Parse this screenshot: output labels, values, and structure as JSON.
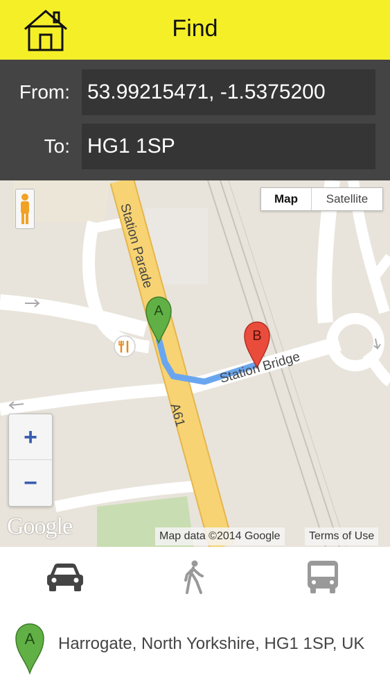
{
  "header": {
    "title": "Find",
    "home_icon": "home-icon",
    "background_color": "#f5ef28"
  },
  "route": {
    "from_label": "From:",
    "from_value": "53.99215471, -1.5375200",
    "to_label": "To:",
    "to_value": "HG1 1SP"
  },
  "map": {
    "type_map_label": "Map",
    "type_satellite_label": "Satellite",
    "zoom_in_label": "+",
    "zoom_out_label": "−",
    "logo_text": "Google",
    "attribution": "Map data ©2014 Google",
    "terms_label": "Terms of Use",
    "streets": [
      "Station Parade",
      "Station Bridge",
      "A61"
    ],
    "marker_start_label": "A",
    "marker_end_label": "B",
    "route_color": "#6aa6ef",
    "icons": [
      "pegman-icon",
      "restaurant-icon"
    ]
  },
  "modes": [
    {
      "name": "car",
      "icon": "car-icon",
      "selected": true
    },
    {
      "name": "walk",
      "icon": "walking-icon",
      "selected": false
    },
    {
      "name": "transit",
      "icon": "bus-icon",
      "selected": false
    }
  ],
  "result": {
    "marker_label": "A",
    "address": "Harrogate, North Yorkshire, HG1 1SP, UK"
  }
}
